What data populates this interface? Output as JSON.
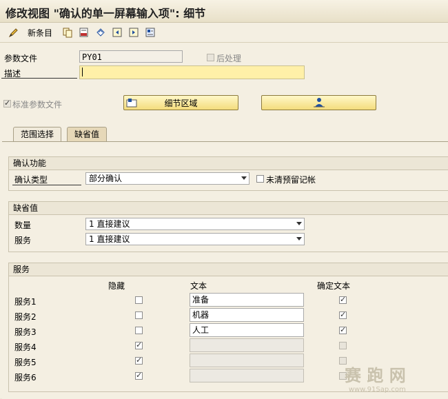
{
  "title": "修改视图 \"确认的单一屏幕输入项\": 细节",
  "toolbar": {
    "new_entry_label": "新条目",
    "icons": [
      "pencil-icon",
      "copy-icon",
      "delete-icon",
      "undo-icon",
      "prev-entry-icon",
      "next-entry-icon",
      "select-icon"
    ]
  },
  "header_fields": {
    "param_file_label": "参数文件",
    "param_file_value": "PY01",
    "postprocess_label": "后处理",
    "description_label": "描述",
    "description_value": "",
    "standard_param_label": "标准参数文件",
    "detail_area_button": "细节区域"
  },
  "tabs": [
    {
      "label": "范围选择",
      "active": false
    },
    {
      "label": "缺省值",
      "active": true
    }
  ],
  "confirm_group": {
    "title": "确认功能",
    "type_label": "确认类型",
    "type_value": "部分确认",
    "unclear_label": "未清预留记帐"
  },
  "default_group": {
    "title": "缺省值",
    "qty_label": "数量",
    "qty_value": "1 直接建议",
    "svc_label": "服务",
    "svc_value": "1 直接建议"
  },
  "services_group": {
    "title": "服务",
    "col_hidden": "隐藏",
    "col_text": "文本",
    "col_confirm_text": "确定文本",
    "rows": [
      {
        "label": "服务1",
        "hidden": false,
        "text": "准备",
        "confirm": true,
        "enabled": true
      },
      {
        "label": "服务2",
        "hidden": false,
        "text": "机器",
        "confirm": true,
        "enabled": true
      },
      {
        "label": "服务3",
        "hidden": false,
        "text": "人工",
        "confirm": true,
        "enabled": true
      },
      {
        "label": "服务4",
        "hidden": true,
        "text": "",
        "confirm": false,
        "enabled": false
      },
      {
        "label": "服务5",
        "hidden": true,
        "text": "",
        "confirm": false,
        "enabled": false
      },
      {
        "label": "服务6",
        "hidden": true,
        "text": "",
        "confirm": false,
        "enabled": false
      }
    ]
  },
  "watermark": "赛 跑 网",
  "watermark_url": "www.91Sap.com"
}
